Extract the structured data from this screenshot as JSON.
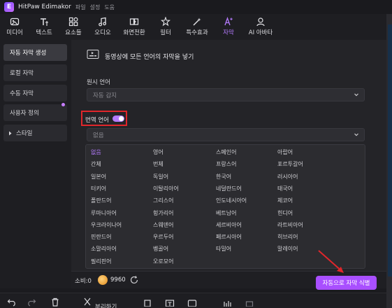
{
  "app": {
    "title": "HitPaw Edimakor",
    "logo_letter": "E"
  },
  "menu": [
    "파일",
    "설정",
    "도움"
  ],
  "toolbar": [
    {
      "label": "미디어",
      "icon": "media-icon"
    },
    {
      "label": "텍스트",
      "icon": "text-icon"
    },
    {
      "label": "요소들",
      "icon": "elements-icon"
    },
    {
      "label": "오디오",
      "icon": "music-icon"
    },
    {
      "label": "화면전환",
      "icon": "transition-icon"
    },
    {
      "label": "필터",
      "icon": "filter-icon"
    },
    {
      "label": "특수효과",
      "icon": "effects-icon"
    },
    {
      "label": "자막",
      "icon": "subtitle-icon",
      "active": true
    },
    {
      "label": "AI 아바타",
      "icon": "avatar-icon"
    }
  ],
  "sidebar": {
    "items": [
      {
        "label": "자동 자막 생성",
        "active": true
      },
      {
        "label": "로컬 자막"
      },
      {
        "label": "수동 자막"
      },
      {
        "label": "사용자 정의"
      },
      {
        "label": "스타일",
        "expandable": true
      }
    ]
  },
  "main": {
    "banner": "동영상에 모든 언어의 자막을 넣기",
    "source_label": "원시 언어",
    "source_value": "자동 감지",
    "translate_label": "번역 언어",
    "translate_enabled": true,
    "translate_value": "없음",
    "languages": [
      [
        "없음",
        "영어",
        "스페인어",
        "아랍어"
      ],
      [
        "간체",
        "번체",
        "프랑스어",
        "포르투갈어"
      ],
      [
        "일본어",
        "독일어",
        "한국어",
        "러시아어"
      ],
      [
        "터키어",
        "이탈리아어",
        "네덜란드어",
        "태국어"
      ],
      [
        "폴란드어",
        "그리스어",
        "인도네시아어",
        "체코어"
      ],
      [
        "루마니아어",
        "헝가리어",
        "베트남어",
        "힌디어"
      ],
      [
        "우크라이나어",
        "스웨덴어",
        "세르비아어",
        "라트비아어"
      ],
      [
        "핀란드어",
        "우르두어",
        "페르시아어",
        "히브리어"
      ],
      [
        "소말리아어",
        "벵골어",
        "타밀어",
        "말레이어"
      ],
      [
        "필리핀어",
        "오로모어",
        "",
        ""
      ]
    ],
    "selected_language": "없음"
  },
  "footer": {
    "cost_label": "소비:0",
    "coins": "9960",
    "cta_label": "자동으로 자막 식별"
  },
  "bottombar": {
    "split_label": "분리하기"
  },
  "colors": {
    "accent": "#b57bff",
    "cta": "#a94fff",
    "highlight": "#e0262b",
    "arrow": "#e0262b"
  }
}
